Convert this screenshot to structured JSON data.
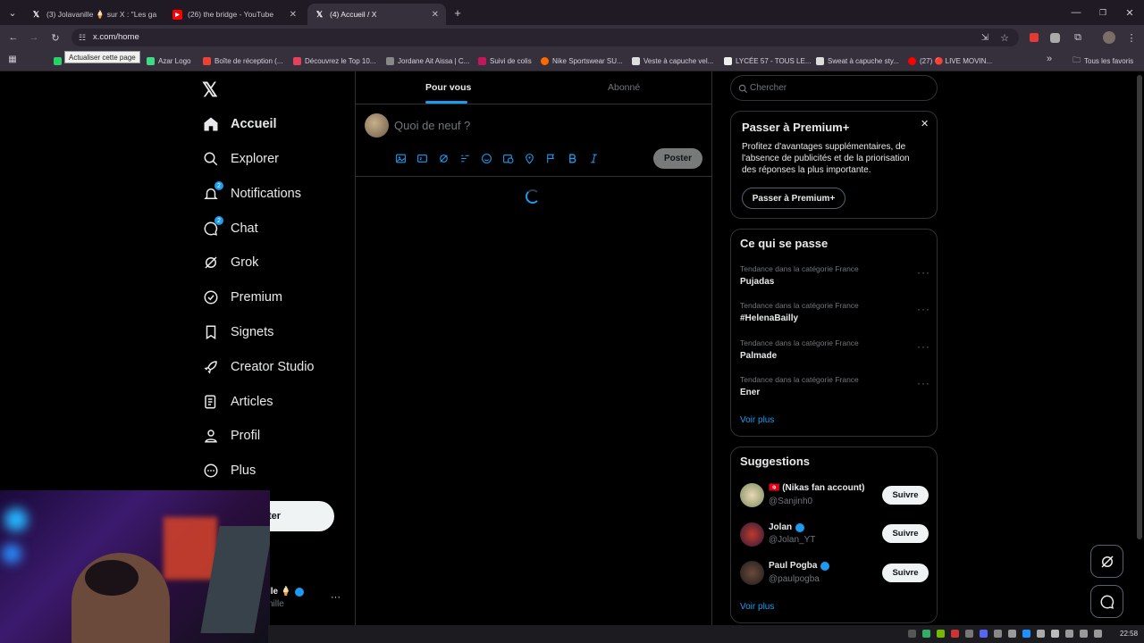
{
  "browser": {
    "tabs": [
      {
        "title": "(3) Jolavanille 🍦 sur X : \"Les ga",
        "favicon": "X"
      },
      {
        "title": "(26) the bridge - YouTube",
        "favicon": "YT"
      },
      {
        "title": "(4) Accueil / X",
        "favicon": "X"
      }
    ],
    "new_tab": "+",
    "url": "x.com/home",
    "tooltip": "Actualiser cette page",
    "bookmarks": [
      {
        "label": "",
        "color": "#25d366"
      },
      {
        "label": "Azar Logo",
        "color": "#3ddc84"
      },
      {
        "label": "Boîte de réception (...",
        "color": "#ea4335"
      },
      {
        "label": "Découvrez le Top 10...",
        "color": "#e4405f"
      },
      {
        "label": "Jordane Ait Aissa | C...",
        "color": "#888888"
      },
      {
        "label": "Suivi de colis",
        "color": "#c2185b"
      },
      {
        "label": "Nike Sportswear SU...",
        "color": "#ff6a00"
      },
      {
        "label": "Veste à capuche vel...",
        "color": "#dddddd"
      },
      {
        "label": "LYCÉE 57 - TOUS LE...",
        "color": "#eeeeee"
      },
      {
        "label": "Sweat à capuche sty...",
        "color": "#dddddd"
      },
      {
        "label": "(27) 🔴 LIVE MOVIN...",
        "color": "#ff0000"
      }
    ],
    "bookmarks_overflow": "»",
    "all_bookmarks": "Tous les favoris"
  },
  "nav": {
    "items": [
      {
        "label": "Accueil",
        "icon": "home-icon"
      },
      {
        "label": "Explorer",
        "icon": "search-icon"
      },
      {
        "label": "Notifications",
        "icon": "bell-icon",
        "badge": "2"
      },
      {
        "label": "Chat",
        "icon": "chat-icon",
        "badge": "2"
      },
      {
        "label": "Grok",
        "icon": "grok-icon"
      },
      {
        "label": "Premium",
        "icon": "premium-icon"
      },
      {
        "label": "Signets",
        "icon": "bookmark-icon"
      },
      {
        "label": "Creator Studio",
        "icon": "rocket-icon"
      },
      {
        "label": "Articles",
        "icon": "articles-icon"
      },
      {
        "label": "Profil",
        "icon": "profile-icon"
      },
      {
        "label": "Plus",
        "icon": "more-circle-icon"
      }
    ],
    "post_button": "ter",
    "account_name": "lle 🍦",
    "account_handle": "nille",
    "account_more": "···"
  },
  "center": {
    "tabs": [
      "Pour vous",
      "Abonné"
    ],
    "composer_placeholder": "Quoi de neuf ?",
    "post_button": "Poster"
  },
  "right": {
    "search_placeholder": "Chercher",
    "premium": {
      "title": "Passer à Premium+",
      "body": "Profitez d'avantages supplémentaires, de l'absence de publicités et de la priorisation des réponses la plus importante.",
      "button": "Passer à Premium+",
      "close": "✕"
    },
    "trends": {
      "title": "Ce qui se passe",
      "items": [
        {
          "context": "Tendance dans la catégorie France",
          "name": "Pujadas"
        },
        {
          "context": "Tendance dans la catégorie France",
          "name": "#HelenaBailly"
        },
        {
          "context": "Tendance dans la catégorie France",
          "name": "Palmade"
        },
        {
          "context": "Tendance dans la catégorie France",
          "name": "Ener"
        }
      ],
      "see_more": "Voir plus"
    },
    "suggestions": {
      "title": "Suggestions",
      "items": [
        {
          "name": "🇹🇳 (Nikas fan account)",
          "handle": "@Sanjinh0",
          "button": "Suivre"
        },
        {
          "name": "Jolan",
          "handle": "@Jolan_YT",
          "button": "Suivre"
        },
        {
          "name": "Paul Pogba",
          "handle": "@paulpogba",
          "button": "Suivre"
        }
      ],
      "see_more": "Voir plus"
    }
  },
  "taskbar": {
    "time": "22:58"
  },
  "colors": {
    "accent": "#1d9bf0",
    "border": "#2f3336",
    "muted": "#71767b"
  }
}
